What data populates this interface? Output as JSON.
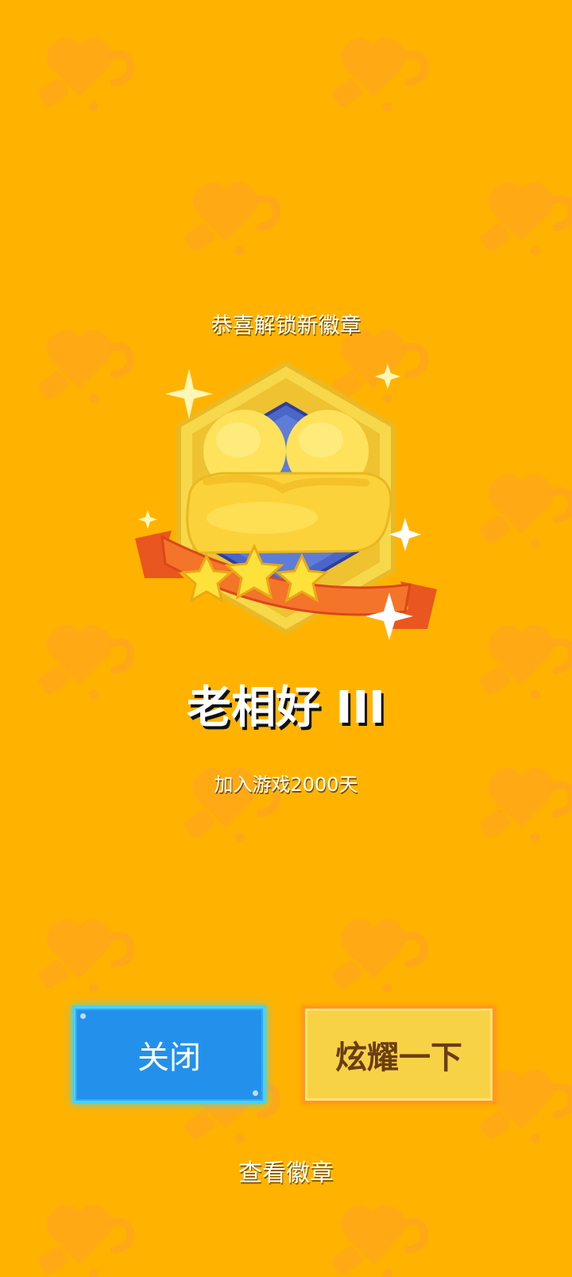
{
  "header": {
    "title": "恭喜解锁新徽章"
  },
  "badge": {
    "name": "老相好 III",
    "description": "加入游戏2000天",
    "stars": 3,
    "icon": "hugging-buddies-medal"
  },
  "buttons": {
    "close_label": "关闭",
    "show_off_label": "炫耀一下"
  },
  "footer": {
    "view_badges_label": "查看徽章"
  },
  "colors": {
    "background": "#FFB300",
    "close_button": "#2391EC",
    "show_off_button": "#F8D245"
  }
}
